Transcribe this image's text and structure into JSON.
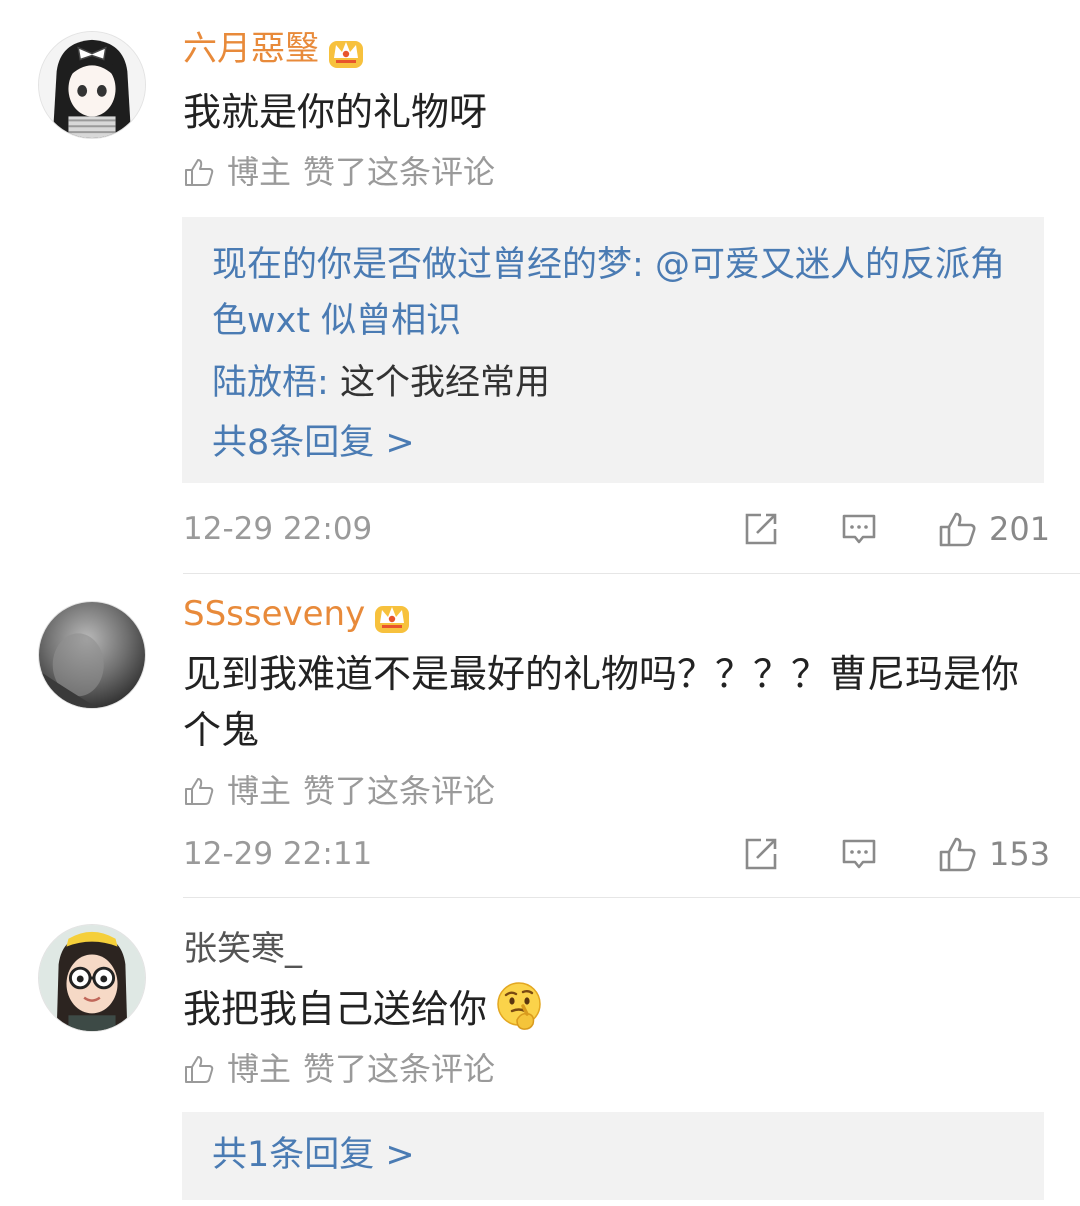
{
  "comments": [
    {
      "username": "六月惡瑿",
      "text": "我就是你的礼物呀",
      "blogger_like": {
        "who": "博主",
        "action": "赞了这条评论"
      },
      "replies": [
        {
          "name": "现在的你是否做过曾经的梦:",
          "text": "@可爱又迷人的反派角色wxt 似曾相识"
        },
        {
          "name": "陆放梧:",
          "text": "这个我经常用"
        }
      ],
      "more_replies": "共8条回复 >",
      "timestamp": "12-29 22:09",
      "likes": "201"
    },
    {
      "username": "SSsseveny",
      "text": "见到我难道不是最好的礼物吗？？？？曹尼玛是你个鬼",
      "blogger_like": {
        "who": "博主",
        "action": "赞了这条评论"
      },
      "timestamp": "12-29 22:11",
      "likes": "153"
    },
    {
      "username": "张笑寒_",
      "text": "我把我自己送给你",
      "blogger_like": {
        "who": "博主",
        "action": "赞了这条评论"
      },
      "more_replies": "共1条回复 >"
    }
  ],
  "colors": {
    "vip_name": "#e88a3a",
    "link_blue": "#4a7bb3",
    "muted_gray": "#9a9a9a",
    "reply_bg": "#f2f2f2"
  },
  "icons": [
    "crown-vip-icon",
    "thumbs-up-icon",
    "share-icon",
    "comment-icon",
    "like-icon",
    "thinking-emoji-icon"
  ]
}
